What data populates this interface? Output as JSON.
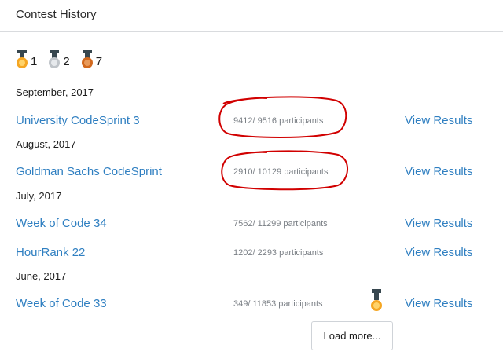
{
  "header": {
    "title": "Contest History"
  },
  "medals": [
    {
      "icon": "gold-medal-icon",
      "count": "1",
      "color": "#f5a623"
    },
    {
      "icon": "silver-medal-icon",
      "count": "2",
      "color": "#bfc4c9"
    },
    {
      "icon": "bronze-medal-icon",
      "count": "7",
      "color": "#d2691e"
    }
  ],
  "groups": [
    {
      "month": "September, 2017",
      "contests": [
        {
          "name": "University CodeSprint 3",
          "participants": "9412/ 9516 participants",
          "action": "View Results"
        }
      ]
    },
    {
      "month": "August, 2017",
      "contests": [
        {
          "name": "Goldman Sachs CodeSprint",
          "participants": "2910/ 10129 participants",
          "action": "View Results"
        }
      ]
    },
    {
      "month": "July, 2017",
      "contests": [
        {
          "name": "Week of Code 34",
          "participants": "7562/ 11299 participants",
          "action": "View Results"
        },
        {
          "name": "HourRank 22",
          "participants": "1202/ 2293 participants",
          "action": "View Results"
        }
      ]
    },
    {
      "month": "June, 2017",
      "contests": [
        {
          "name": "Week of Code 33",
          "participants": "349/ 11853 participants",
          "action": "View Results",
          "medal": "bronze-medal-icon"
        }
      ]
    }
  ],
  "footer": {
    "load_more": "Load more..."
  },
  "colors": {
    "link": "#2f7fc1",
    "annotation": "#d10000"
  }
}
